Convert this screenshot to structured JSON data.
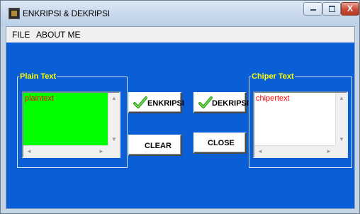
{
  "window": {
    "title": "ENKRIPSI & DEKRIPSI",
    "close_glyph": "X"
  },
  "menu": {
    "file": "FILE",
    "about": "ABOUT ME"
  },
  "plain_group": {
    "label": "Plain Text",
    "value": "plaintext",
    "bg_color": "#00ff00"
  },
  "chiper_group": {
    "label": "Chiper Text",
    "value": "chipertext",
    "bg_color": "#ffffff"
  },
  "buttons": {
    "encrypt": "ENKRIPSI",
    "decrypt": "DEKRIPSI",
    "clear": "CLEAR",
    "close": "CLOSE"
  },
  "colors": {
    "panel": "#0a5fd6",
    "group_label": "#ffff00",
    "memo_text": "#ff0000",
    "check_icon": "#2e9e1f"
  }
}
